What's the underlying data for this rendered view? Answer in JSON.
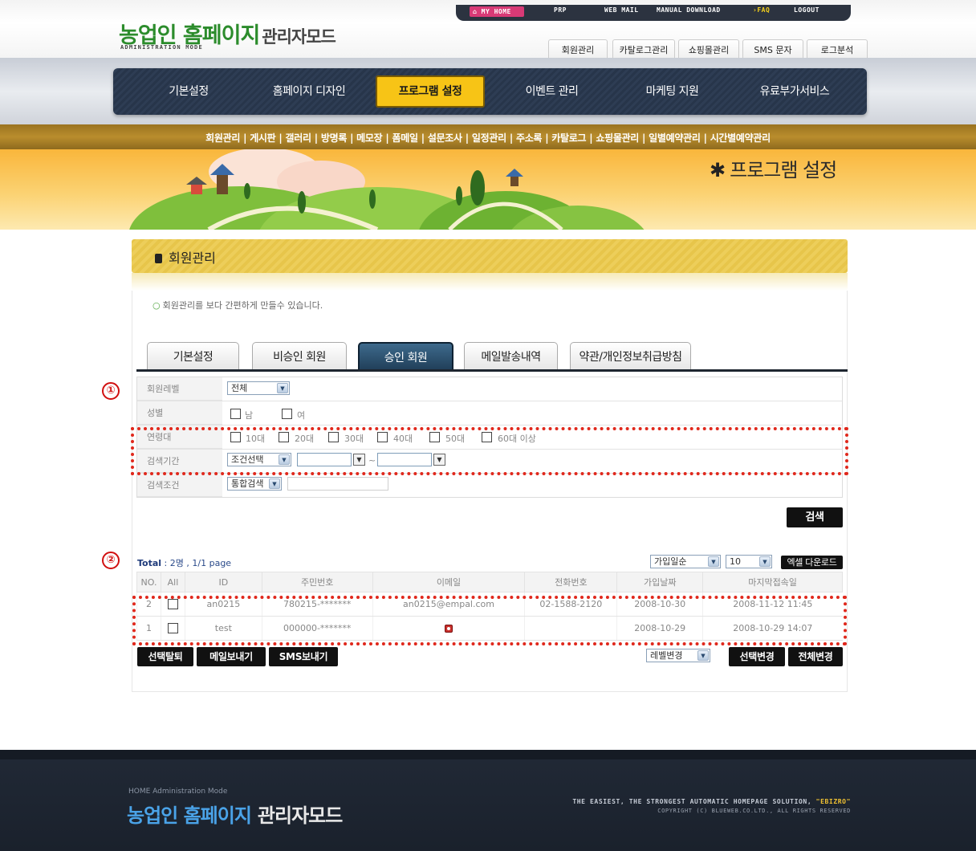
{
  "header": {
    "util_links": {
      "my_home": "MY HOME",
      "prp": "PRP",
      "web_mail": "WEB MAIL",
      "manual_download": "MANUAL DOWNLOAD",
      "faq": "FAQ",
      "logout": "LOGOUT"
    },
    "logo_main": "농업인 홈페이지",
    "logo_mode": "관리자모드",
    "logo_sub": "ADMINISTRATION MODE",
    "quick_tabs": [
      "회원관리",
      "카탈로그관리",
      "쇼핑몰관리",
      "SMS 문자",
      "로그분석"
    ]
  },
  "nav": {
    "items": [
      "기본설정",
      "홈페이지 디자인",
      "프로그램 설정",
      "이벤트 관리",
      "마케팅 지원",
      "유료부가서비스"
    ],
    "active": "프로그램 설정"
  },
  "submenu": [
    "회원관리",
    "게시판",
    "갤러리",
    "방명록",
    "메모장",
    "폼메일",
    "설문조사",
    "일정관리",
    "주소록",
    "카탈로그",
    "쇼핑몰관리",
    "일별예약관리",
    "시간별예약관리"
  ],
  "banner": {
    "title": "프로그램 설정"
  },
  "section": {
    "title": "회원관리",
    "description": "회원관리를 보다 간편하게 만들수 있습니다."
  },
  "tabs": [
    "기본설정",
    "비승인 회원",
    "승인 회원",
    "메일발송내역",
    "약관/개인정보취급방침"
  ],
  "active_tab": "승인 회원",
  "form": {
    "labels": {
      "level": "회원레벨",
      "gender": "성별",
      "age": "연령대",
      "period": "검색기간",
      "condition": "검색조건"
    },
    "level_value": "전체",
    "gender_options": [
      "남",
      "여"
    ],
    "age_options": [
      "10대",
      "20대",
      "30대",
      "40대",
      "50대",
      "60대 이상"
    ],
    "period_select": "조건선택",
    "date_separator": "~",
    "condition_select": "통합검색",
    "search_button": "검색"
  },
  "annotations": [
    "①",
    "②"
  ],
  "list": {
    "total_label": "Total",
    "total_count": "2명",
    "page_info": "1/1 page",
    "sort_select": "가입일순",
    "per_page_select": "10",
    "excel_button": "엑셀 다운로드",
    "columns": [
      "NO.",
      "All",
      "ID",
      "주민번호",
      "이메일",
      "전화번호",
      "가입날짜",
      "마지막접속일"
    ],
    "rows": [
      {
        "no": "2",
        "id": "an0215",
        "ssn": "780215-*******",
        "email": "an0215@empal.com",
        "phone": "02-1588-2120",
        "joined": "2008-10-30",
        "last_login": "2008-11-12 11:45"
      },
      {
        "no": "1",
        "id": "test",
        "ssn": "000000-*******",
        "email": "",
        "phone": "",
        "joined": "2008-10-29",
        "last_login": "2008-10-29 14:07"
      }
    ]
  },
  "actions": {
    "withdraw": "선택탈퇴",
    "send_mail": "메일보내기",
    "send_sms": "SMS보내기",
    "level_select": "레벨변경",
    "change_selected": "선택변경",
    "change_all": "전체변경"
  },
  "footer": {
    "mini": "HOME Administration Mode",
    "logo_main": "농업인 홈페이지",
    "logo_mode": "관리자모드",
    "slogan": "THE EASIEST, THE STRONGEST AUTOMATIC HOMEPAGE SOLUTION,",
    "brand": "\"EBIZRO\"",
    "copyright": "COPYRIGHT (C) BLUEWEB.CO.LTD., ALL RIGHTS RESERVED"
  },
  "colors": {
    "nav_bg": "#27354a",
    "nav_active": "#f7c416",
    "submenu_bg": "#b08427",
    "annotation_red": "#e0281c",
    "logo_green": "#2c8c2c"
  }
}
